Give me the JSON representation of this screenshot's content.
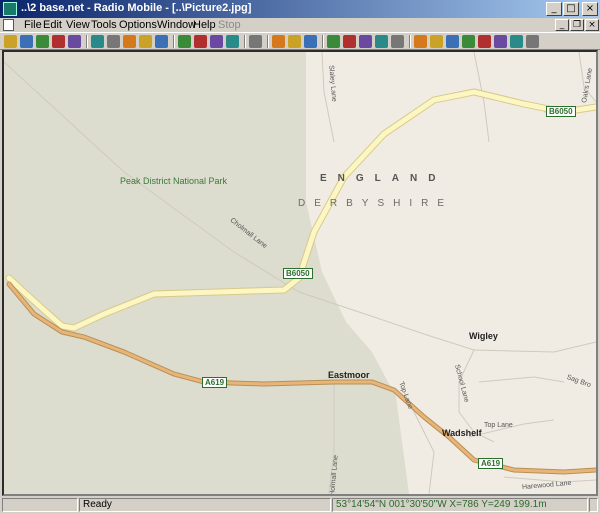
{
  "window": {
    "title": "..\\2 base.net - Radio Mobile - [..\\Picture2.jpg]"
  },
  "title_buttons": {
    "minimize": "_",
    "maximize": "□",
    "close": "×"
  },
  "menu": {
    "items": [
      "File",
      "Edit",
      "View",
      "Tools",
      "Options",
      "Window",
      "Help",
      "Stop"
    ],
    "disabled": [
      "Stop"
    ]
  },
  "mdi_buttons": {
    "minimize": "_",
    "restore": "❐",
    "close": "×"
  },
  "toolbar": {
    "icons": [
      "new-icon",
      "open-icon",
      "save-icon",
      "network-properties-icon",
      "unit-properties-icon",
      "separator",
      "world-map-icon",
      "merge-pictures-icon",
      "elevation-grid-icon",
      "pan-left-icon",
      "pan-right-icon",
      "separator",
      "frame-icon",
      "copy-picture-icon",
      "save-picture-icon",
      "pdf-icon",
      "separator",
      "print-icon",
      "separator",
      "copy-icon",
      "paste-icon",
      "map-properties-icon",
      "separator",
      "picture-properties-icon",
      "fit-zoom-icon",
      "select-area-icon",
      "crosshair-icon",
      "delete-icon",
      "separator",
      "radio-link-icon",
      "coverage-icon",
      "polar-coverage-icon",
      "antenna-tower-icon",
      "visual-coverage-icon",
      "rgb-plot-icon",
      "elevation-icon",
      "histogram-icon"
    ]
  },
  "map": {
    "country": "ENGLAND",
    "county": "DERBYSHIRE",
    "park": "Peak District National Park",
    "places": [
      "Wigley",
      "Eastmoor",
      "Wadshelf"
    ],
    "roads": {
      "B6050_a": "B6050",
      "B6050_b": "B6050",
      "A619_a": "A619",
      "A619_b": "A619"
    },
    "lanes": [
      "Slaley Lane",
      "Oxford Lane",
      "Cholmall Lane",
      "School Lane",
      "Sag Bro",
      "Top Lane",
      "Top Lane",
      "Harewood Lane",
      "Holmall Lane",
      "Oak's Lane"
    ]
  },
  "status": {
    "left": "",
    "message": "Ready",
    "coords": "53°14'54\"N 001°30'50\"W  X=786 Y=249 199.1m",
    "right": ""
  }
}
